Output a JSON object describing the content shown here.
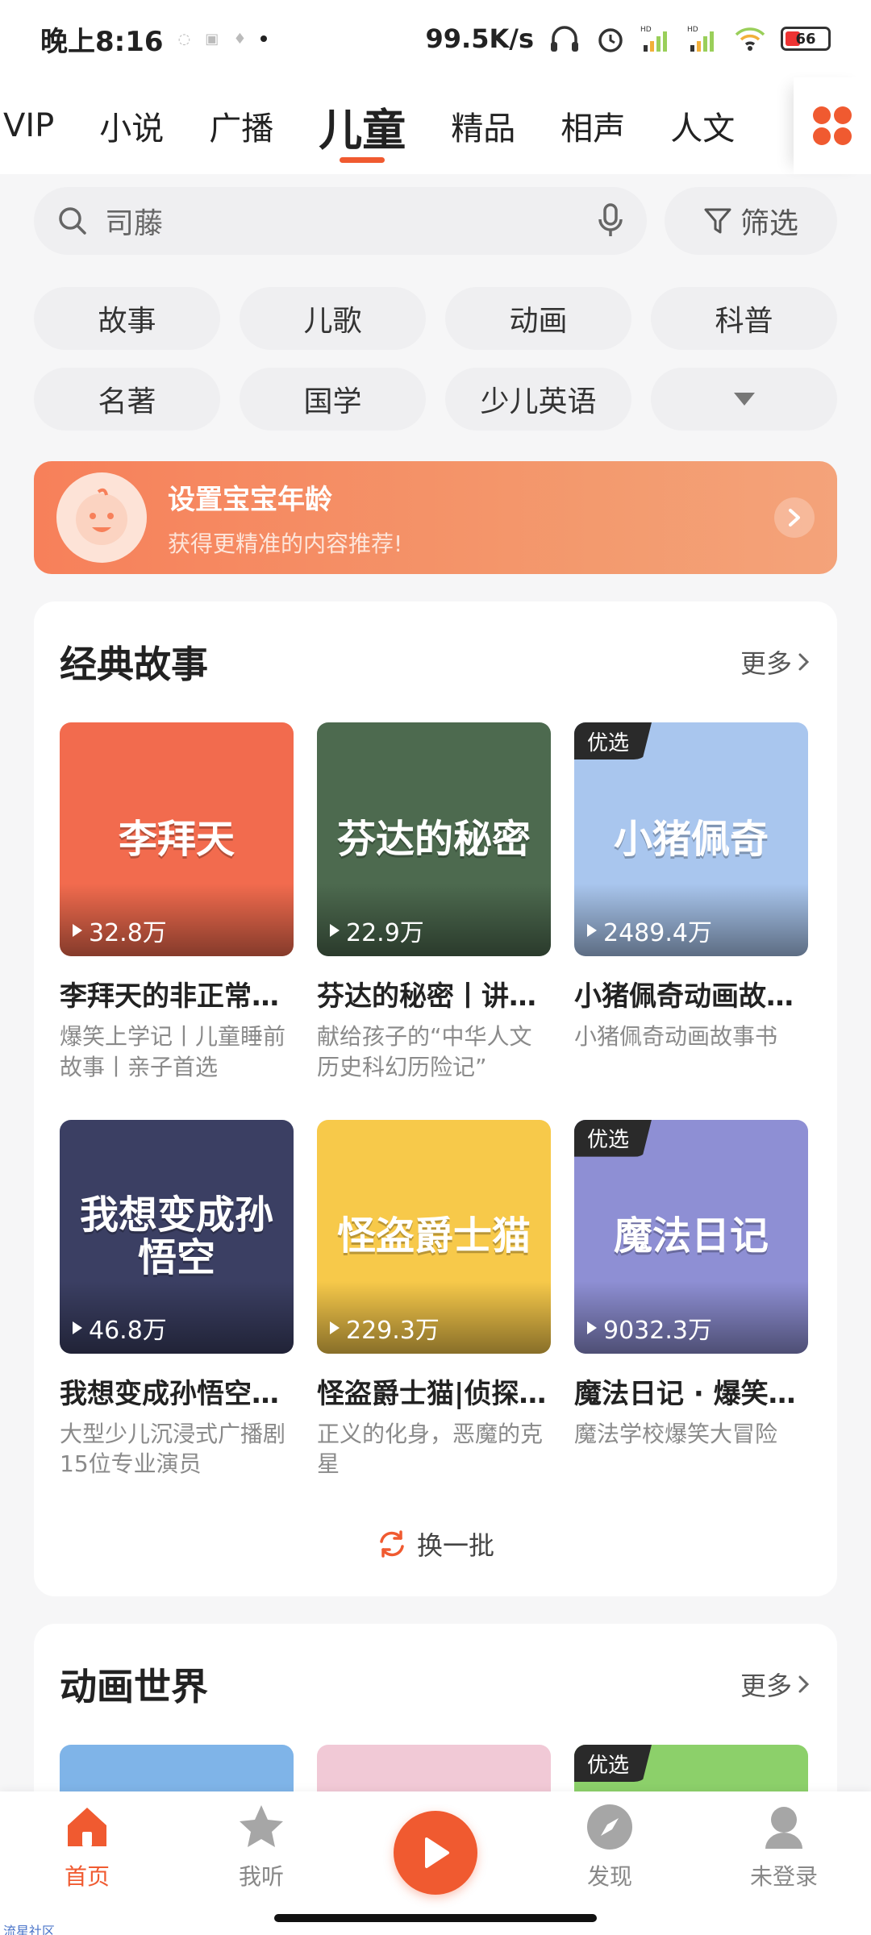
{
  "status_bar": {
    "time": "晚上8:16",
    "speed": "99.5K/s",
    "battery": "66"
  },
  "tabs": [
    {
      "label": "VIP",
      "active": false
    },
    {
      "label": "小说",
      "active": false
    },
    {
      "label": "广播",
      "active": false
    },
    {
      "label": "儿童",
      "active": true
    },
    {
      "label": "精品",
      "active": false
    },
    {
      "label": "相声",
      "active": false
    },
    {
      "label": "人文",
      "active": false
    }
  ],
  "search": {
    "placeholder": "司藤",
    "filter_label": "筛选"
  },
  "chips": [
    "故事",
    "儿歌",
    "动画",
    "科普",
    "名著",
    "国学",
    "少儿英语"
  ],
  "banner": {
    "title": "设置宝宝年龄",
    "subtitle": "获得更精准的内容推荐!"
  },
  "section1": {
    "title": "经典故事",
    "more": "更多",
    "refresh": "换一批",
    "items": [
      {
        "cover_text": "李拜天",
        "plays": "32.8万",
        "title": "李拜天的非正常日常",
        "desc": "爆笑上学记丨儿童睡前故事丨亲子首选",
        "badge": "",
        "color": "#f26b4e"
      },
      {
        "cover_text": "芬达的秘密",
        "plays": "22.9万",
        "title": "芬达的秘密丨讲给孩子",
        "desc": "献给孩子的“中华人文历史科幻历险记”",
        "badge": "",
        "color": "#4d6a4f"
      },
      {
        "cover_text": "小猪佩奇",
        "plays": "2489.4万",
        "title": "小猪佩奇动画故事书",
        "desc": "小猪佩奇动画故事书",
        "badge": "优选",
        "color": "#a9c6ee"
      },
      {
        "cover_text": "我想变成孙悟空",
        "plays": "46.8万",
        "title": "我想变成孙悟空丨大型",
        "desc": "大型少儿沉浸式广播剧 15位专业演员",
        "badge": "",
        "color": "#3b3f63"
      },
      {
        "cover_text": "怪盗爵士猫",
        "plays": "229.3万",
        "title": "怪盗爵士猫|侦探故事",
        "desc": "正义的化身，恶魔的克星",
        "badge": "",
        "color": "#f7c94a"
      },
      {
        "cover_text": "魔法日记",
        "plays": "9032.3万",
        "title": "魔法日记 · 爆笑校园",
        "desc": "魔法学校爆笑大冒险",
        "badge": "优选",
        "color": "#8e8fd4"
      }
    ]
  },
  "section2": {
    "title": "动画世界",
    "more": "更多",
    "items": [
      {
        "badge": "",
        "color": "#7fb4e8"
      },
      {
        "badge": "",
        "color": "#f1c9d6"
      },
      {
        "badge": "优选",
        "color": "#8cd06a"
      }
    ]
  },
  "bottom_nav": [
    {
      "label": "首页",
      "icon": "home-icon",
      "active": true
    },
    {
      "label": "我听",
      "icon": "star-icon",
      "active": false
    },
    {
      "label": "",
      "icon": "play-icon",
      "active": false
    },
    {
      "label": "发现",
      "icon": "compass-icon",
      "active": false
    },
    {
      "label": "未登录",
      "icon": "user-icon",
      "active": false
    }
  ],
  "watermark": "流星社区",
  "colors": {
    "accent": "#f05a30",
    "banner": "#f7805a"
  }
}
